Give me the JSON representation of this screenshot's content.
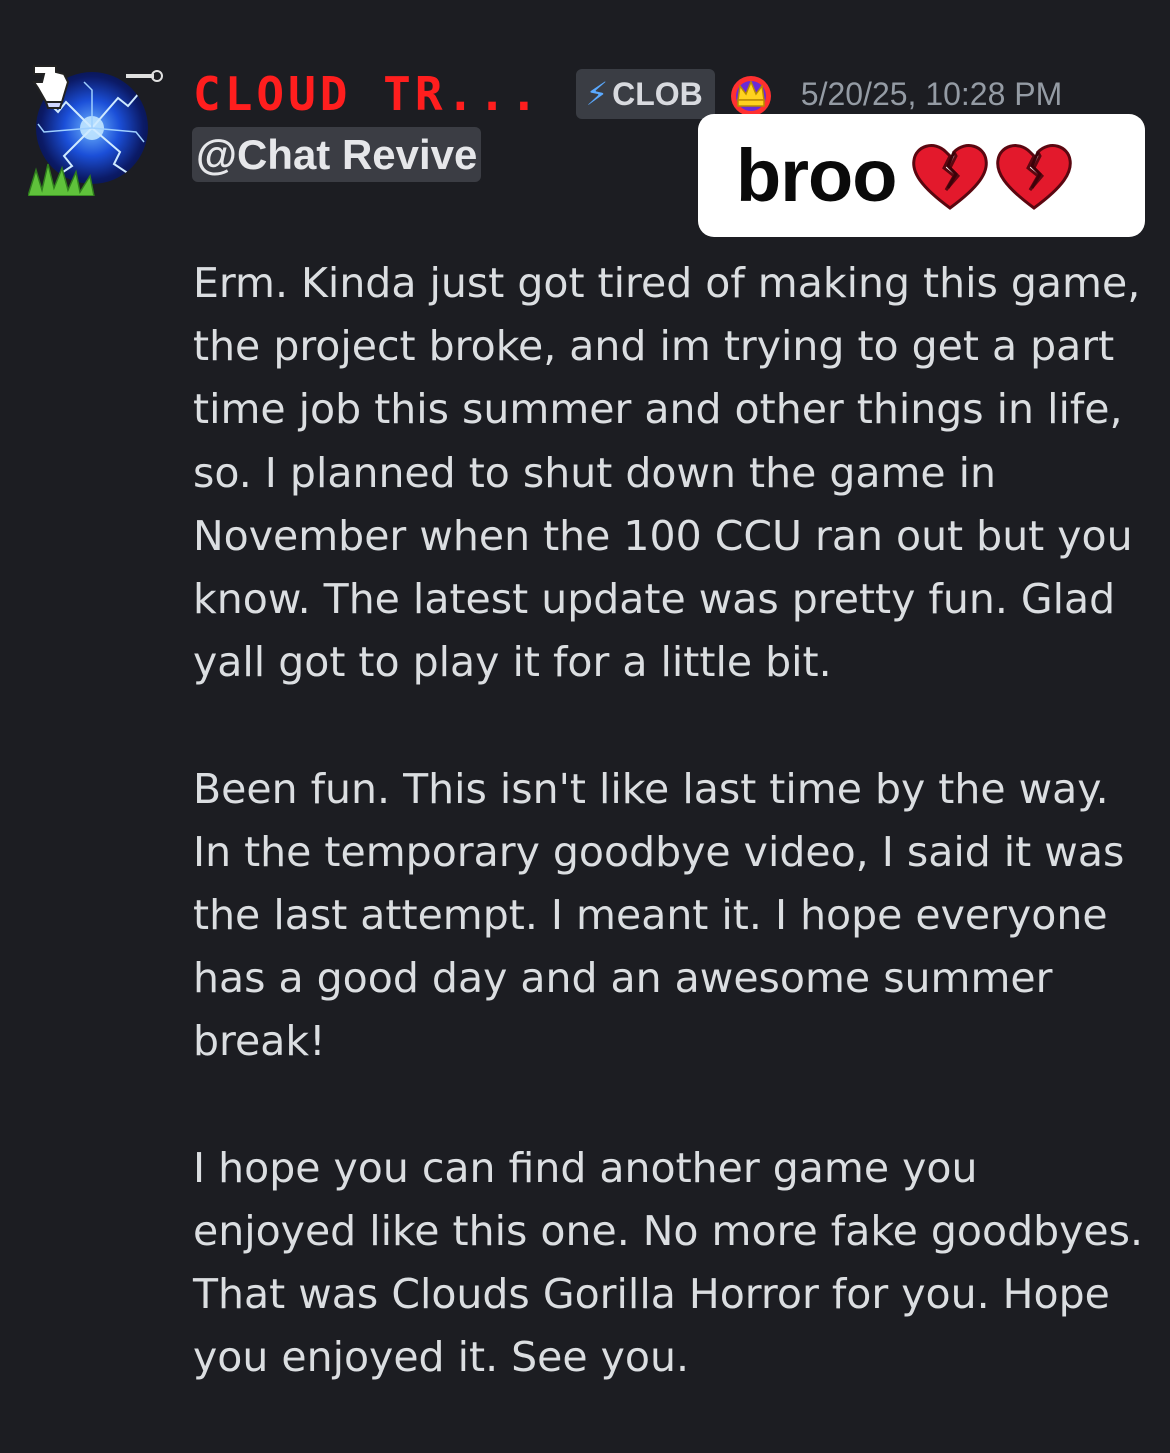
{
  "message": {
    "author": {
      "username": "CLOUD TR...",
      "tag": {
        "icon": "lightning-icon",
        "label": "CLOB"
      },
      "badge_icon": "crown-icon"
    },
    "timestamp": "5/20/25, 10:28 PM",
    "mention": "@Chat Revive",
    "paragraphs": [
      "Erm. Kinda just got tired of making this game, the project broke, and im trying to get a part time job this summer and other things in life, so. I planned to shut down the game in November when the 100 CCU ran out but you know. The latest update was pretty fun. Glad yall got to play it for a little bit.",
      "Been fun. This isn't like last time by the way. In the temporary goodbye video, I said it was the last attempt. I meant it. I hope everyone has a good day and an awesome summer break!",
      "I hope you can find another game you enjoyed like this one. No more fake goodbyes. That was Clouds Gorilla Horror for you. Hope you enjoyed it. See you."
    ]
  },
  "overlay": {
    "text": "broo",
    "emoji": [
      "broken-heart-icon",
      "broken-heart-icon"
    ]
  },
  "colors": {
    "background": "#1c1d22",
    "username": "#ff1e1e",
    "timestamp": "#949ba4",
    "message_text": "#dbdee1",
    "tag_bg": "#3a3d44",
    "mention_bg": "#3b3d44"
  }
}
